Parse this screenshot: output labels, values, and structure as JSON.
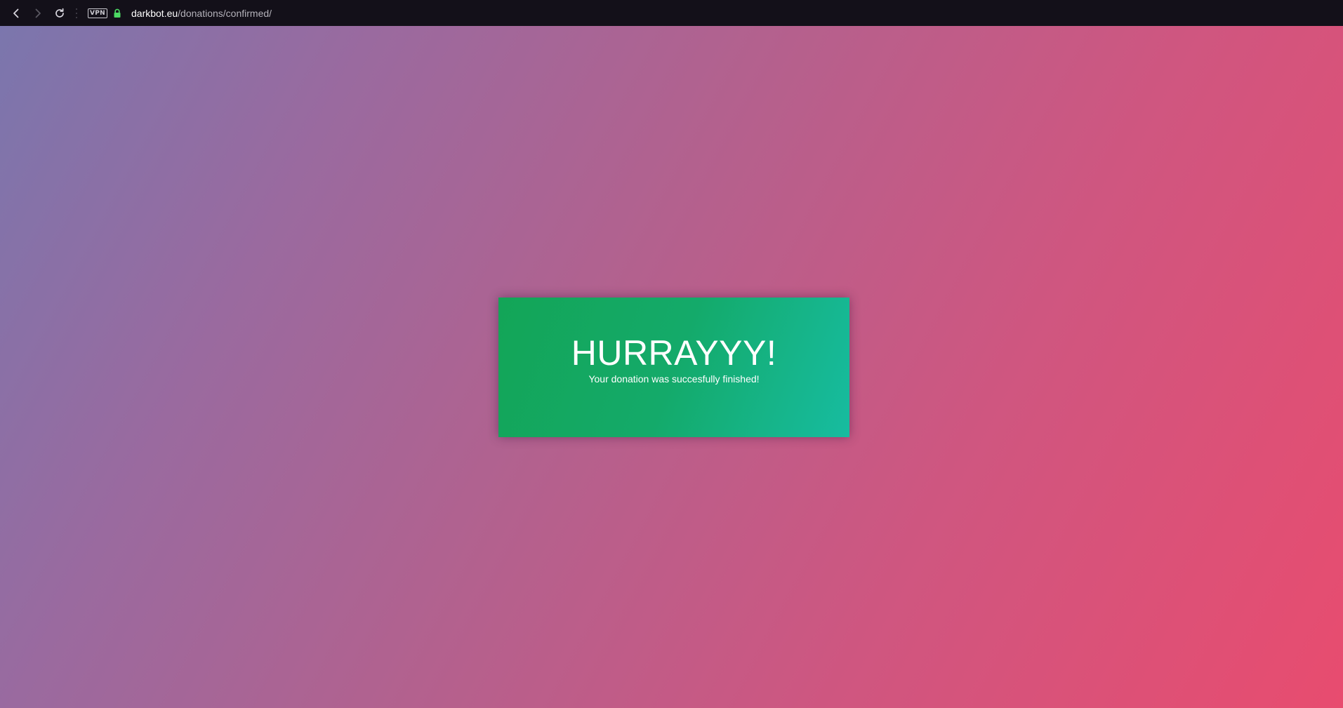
{
  "browser": {
    "vpn_label": "VPN",
    "url_host": "darkbot.eu",
    "url_path": "/donations/confirmed/",
    "icons": {
      "back": "chevron-left-icon",
      "forward": "chevron-right-icon",
      "reload": "reload-icon",
      "lock": "lock-icon"
    },
    "colors": {
      "toolbar_bg": "#131019",
      "lock": "#4cd964"
    }
  },
  "page": {
    "title": "HURRAYYY!",
    "message": "Your donation was succesfully finished!",
    "colors": {
      "gradient_start": "#7b76ad",
      "gradient_end": "#e84c6f",
      "card_start": "#13a557",
      "card_end": "#17bca0"
    }
  }
}
